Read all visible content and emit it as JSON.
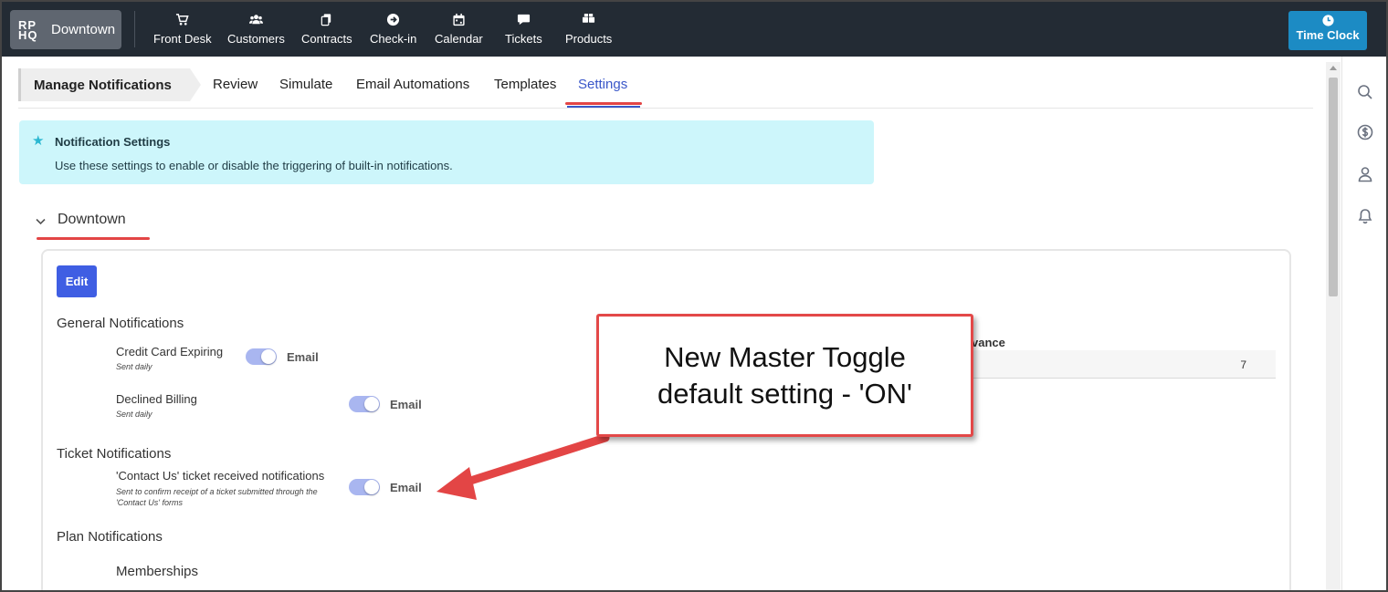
{
  "brand": {
    "logo": "RP HQ",
    "location": "Downtown"
  },
  "nav": [
    {
      "label": "Front Desk",
      "icon": "cart-icon"
    },
    {
      "label": "Customers",
      "icon": "users-icon"
    },
    {
      "label": "Contracts",
      "icon": "copy-icon"
    },
    {
      "label": "Check-in",
      "icon": "arrow-circle-icon"
    },
    {
      "label": "Calendar",
      "icon": "calendar-icon"
    },
    {
      "label": "Tickets",
      "icon": "chat-icon"
    },
    {
      "label": "Products",
      "icon": "boxes-icon"
    }
  ],
  "time_clock": {
    "label": "Time Clock",
    "icon": "clock-icon"
  },
  "rail_icons": [
    "search-icon",
    "dollar-icon",
    "user-icon",
    "bell-icon"
  ],
  "page": {
    "breadcrumb": "Manage Notifications",
    "tabs": [
      {
        "label": "Review"
      },
      {
        "label": "Simulate"
      },
      {
        "label": "Email Automations"
      },
      {
        "label": "Templates"
      },
      {
        "label": "Settings",
        "active": true
      }
    ]
  },
  "info": {
    "title": "Notification Settings",
    "text": "Use these settings to enable or disable the triggering of built-in notifications."
  },
  "section": {
    "title": "Downtown",
    "edit_label": "Edit",
    "groups": {
      "general": {
        "title": "General Notifications",
        "items": [
          {
            "name": "Credit Card Expiring",
            "sub": "Sent daily",
            "channel": "Email",
            "on": true
          },
          {
            "name": "Declined Billing",
            "sub": "Sent daily",
            "channel": "Email",
            "on": true
          }
        ]
      },
      "ticket": {
        "title": "Ticket Notifications",
        "items": [
          {
            "name": "'Contact Us' ticket received notifications",
            "sub_line1": "Sent to confirm receipt of a ticket submitted through the",
            "sub_line2": "'Contact Us' forms",
            "channel": "Email",
            "on": true
          }
        ]
      },
      "plan": {
        "title": "Plan Notifications",
        "sub_title": "Memberships"
      }
    },
    "table": {
      "header": "vance",
      "value": "7"
    }
  },
  "callout": {
    "line1": "New Master Toggle",
    "line2": "default setting - 'ON'"
  },
  "colors": {
    "topbar": "#232b34",
    "accent": "#3f5ee3",
    "annotation": "#e34545",
    "info_bg": "#cdf6fb"
  }
}
